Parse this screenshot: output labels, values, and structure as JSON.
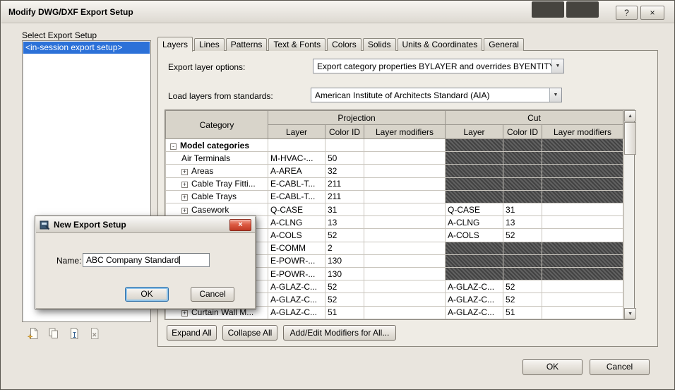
{
  "window": {
    "title": "Modify DWG/DXF Export Setup"
  },
  "icons": {
    "help": "?",
    "close": "×",
    "modal_close": "×",
    "dropdown_arrow": "▼",
    "scroll_up": "▲",
    "scroll_down": "▼"
  },
  "sidebar": {
    "label": "Select Export Setup",
    "items": [
      {
        "label": "<in-session export setup>",
        "selected": true
      }
    ],
    "toolbar_icons": [
      "new-export-setup-icon",
      "duplicate-export-setup-icon",
      "rename-export-setup-icon",
      "delete-export-setup-icon"
    ]
  },
  "tabs": [
    {
      "label": "Layers",
      "active": true
    },
    {
      "label": "Lines",
      "active": false
    },
    {
      "label": "Patterns",
      "active": false
    },
    {
      "label": "Text & Fonts",
      "active": false
    },
    {
      "label": "Colors",
      "active": false
    },
    {
      "label": "Solids",
      "active": false
    },
    {
      "label": "Units & Coordinates",
      "active": false
    },
    {
      "label": "General",
      "active": false
    }
  ],
  "layers_tab": {
    "export_layer_options_label": "Export layer options:",
    "export_layer_options_value": "Export category properties BYLAYER and overrides BYENTITY",
    "load_layers_label": "Load layers from standards:",
    "load_layers_value": "American Institute of Architects Standard (AIA)",
    "buttons": {
      "expand_all": "Expand All",
      "collapse_all": "Collapse All",
      "add_edit_modifiers": "Add/Edit Modifiers for All..."
    }
  },
  "table": {
    "headers": {
      "category": "Category",
      "projection": "Projection",
      "cut": "Cut",
      "layer": "Layer",
      "color_id": "Color ID",
      "layer_modifiers": "Layer modifiers"
    },
    "expander_icons": {
      "expanded": "-",
      "collapsed": "+"
    },
    "rows": [
      {
        "category": "Model categories",
        "level": 0,
        "expander": "expanded",
        "projection": {
          "layer": "",
          "color_id": "",
          "modifiers": ""
        },
        "cut": {
          "hatched": true
        }
      },
      {
        "category": "Air Terminals",
        "level": 1,
        "expander": null,
        "projection": {
          "layer": "M-HVAC-...",
          "color_id": "50",
          "modifiers": ""
        },
        "cut": {
          "hatched": true
        }
      },
      {
        "category": "Areas",
        "level": 1,
        "expander": "collapsed",
        "projection": {
          "layer": "A-AREA",
          "color_id": "32",
          "modifiers": ""
        },
        "cut": {
          "hatched": true
        }
      },
      {
        "category": "Cable Tray Fitti...",
        "level": 1,
        "expander": "collapsed",
        "projection": {
          "layer": "E-CABL-T...",
          "color_id": "211",
          "modifiers": ""
        },
        "cut": {
          "hatched": true
        }
      },
      {
        "category": "Cable Trays",
        "level": 1,
        "expander": "collapsed",
        "projection": {
          "layer": "E-CABL-T...",
          "color_id": "211",
          "modifiers": ""
        },
        "cut": {
          "hatched": true
        }
      },
      {
        "category": "Casework",
        "level": 1,
        "expander": "collapsed",
        "projection": {
          "layer": "Q-CASE",
          "color_id": "31",
          "modifiers": ""
        },
        "cut": {
          "hatched": false,
          "layer": "Q-CASE",
          "color_id": "31",
          "modifiers": ""
        }
      },
      {
        "category": "",
        "level": 1,
        "expander": null,
        "projection": {
          "layer": "A-CLNG",
          "color_id": "13",
          "modifiers": ""
        },
        "cut": {
          "hatched": false,
          "layer": "A-CLNG",
          "color_id": "13",
          "modifiers": ""
        }
      },
      {
        "category": "",
        "level": 1,
        "expander": null,
        "projection": {
          "layer": "A-COLS",
          "color_id": "52",
          "modifiers": ""
        },
        "cut": {
          "hatched": false,
          "layer": "A-COLS",
          "color_id": "52",
          "modifiers": ""
        }
      },
      {
        "category": "",
        "level": 1,
        "expander": null,
        "projection": {
          "layer": "E-COMM",
          "color_id": "2",
          "modifiers": ""
        },
        "cut": {
          "hatched": true
        }
      },
      {
        "category": "",
        "level": 1,
        "expander": null,
        "projection": {
          "layer": "E-POWR-...",
          "color_id": "130",
          "modifiers": ""
        },
        "cut": {
          "hatched": true
        }
      },
      {
        "category": "",
        "level": 1,
        "expander": null,
        "projection": {
          "layer": "E-POWR-...",
          "color_id": "130",
          "modifiers": ""
        },
        "cut": {
          "hatched": true
        }
      },
      {
        "category": "",
        "level": 1,
        "expander": null,
        "projection": {
          "layer": "A-GLAZ-C...",
          "color_id": "52",
          "modifiers": ""
        },
        "cut": {
          "hatched": false,
          "layer": "A-GLAZ-C...",
          "color_id": "52",
          "modifiers": ""
        }
      },
      {
        "category": "",
        "level": 1,
        "expander": null,
        "projection": {
          "layer": "A-GLAZ-C...",
          "color_id": "52",
          "modifiers": ""
        },
        "cut": {
          "hatched": false,
          "layer": "A-GLAZ-C...",
          "color_id": "52",
          "modifiers": ""
        }
      },
      {
        "category": "Curtain Wall M...",
        "level": 1,
        "expander": "collapsed",
        "projection": {
          "layer": "A-GLAZ-C...",
          "color_id": "51",
          "modifiers": ""
        },
        "cut": {
          "hatched": false,
          "layer": "A-GLAZ-C...",
          "color_id": "51",
          "modifiers": ""
        }
      }
    ]
  },
  "footer": {
    "ok": "OK",
    "cancel": "Cancel"
  },
  "modal": {
    "title": "New Export Setup",
    "name_label": "Name:",
    "name_value": "ABC Company Standard",
    "ok": "OK",
    "cancel": "Cancel"
  }
}
